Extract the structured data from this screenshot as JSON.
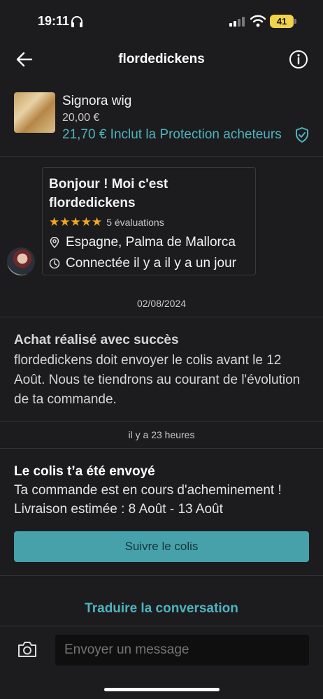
{
  "status_bar": {
    "time": "19:11",
    "battery": "41"
  },
  "header": {
    "title": "flordedickens"
  },
  "product": {
    "title": "Signora wig",
    "price": "20,00 €",
    "protection_text": "21,70 € Inclut la Protection acheteurs"
  },
  "profile_card": {
    "greeting": "Bonjour ! Moi c'est flordedickens",
    "stars": "★★★★★",
    "reviews": "5 évaluations",
    "location": "Espagne, Palma de Mallorca",
    "last_seen": "Connectée il y a il y a un jour"
  },
  "timeline": {
    "date1": "02/08/2024",
    "purchase_title": "Achat réalisé avec succès",
    "purchase_body": "flordedickens doit envoyer le colis avant le 12 Août. Nous te tiendrons au courant de l'évolution de ta commande.",
    "date2": "il y a 23 heures",
    "shipped_title": "Le colis t’a été envoyé",
    "shipped_line1": "Ta commande est en cours d'acheminement !",
    "shipped_line2": "Livraison estimée :  8 Août - 13 Août",
    "track_button": "Suivre le colis"
  },
  "translate_link": "Traduire la conversation",
  "composer": {
    "placeholder": "Envoyer un message"
  },
  "colors": {
    "accent": "#4fb3bf",
    "button": "#46a1ab",
    "background": "#1c1c1e",
    "stars": "#f2a81d"
  },
  "icons": [
    "headphones-icon",
    "signal-icon",
    "wifi-icon",
    "back-arrow-icon",
    "info-icon",
    "shield-check-icon",
    "location-pin-icon",
    "clock-icon",
    "camera-icon"
  ]
}
